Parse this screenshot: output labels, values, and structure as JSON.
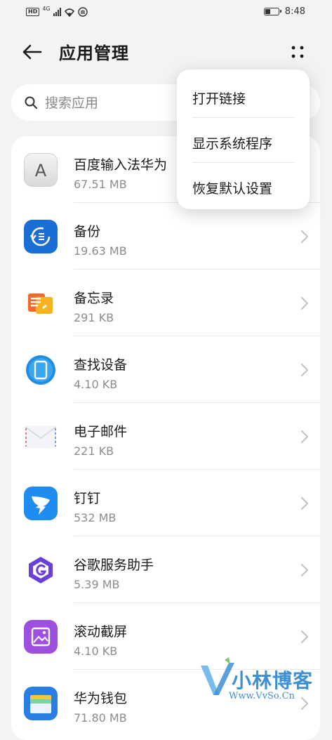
{
  "status_bar": {
    "network_badge": "HD",
    "network_type": "4G",
    "time": "8:48",
    "battery_level": 0.4
  },
  "header": {
    "title": "应用管理",
    "back_icon": "arrow-left-icon",
    "more_icon": "more-dots-icon"
  },
  "search": {
    "placeholder": "搜索应用",
    "value": ""
  },
  "apps": [
    {
      "name": "百度输入法华为",
      "size": "67.51 MB",
      "icon": "baidu-input-icon"
    },
    {
      "name": "备份",
      "size": "19.63 MB",
      "icon": "backup-icon"
    },
    {
      "name": "备忘录",
      "size": "291 KB",
      "icon": "notepad-icon"
    },
    {
      "name": "查找设备",
      "size": "4.10 KB",
      "icon": "find-device-icon"
    },
    {
      "name": "电子邮件",
      "size": "221 KB",
      "icon": "email-icon"
    },
    {
      "name": "钉钉",
      "size": "532 MB",
      "icon": "dingtalk-icon"
    },
    {
      "name": "谷歌服务助手",
      "size": "5.39 MB",
      "icon": "google-helper-icon"
    },
    {
      "name": "滚动截屏",
      "size": "4.10 KB",
      "icon": "scroll-screenshot-icon"
    },
    {
      "name": "华为钱包",
      "size": "71.80 MB",
      "icon": "wallet-icon"
    }
  ],
  "menu": {
    "items": [
      {
        "label": "打开链接"
      },
      {
        "label": "显示系统程序"
      },
      {
        "label": "恢复默认设置"
      }
    ]
  },
  "watermark": {
    "text": "小林博客",
    "url": "Www.VvSo.Cn"
  },
  "colors": {
    "background": "#f1f3f5",
    "card": "#ffffff",
    "text_primary": "#1a1a1a",
    "text_secondary": "#8c8c8c",
    "watermark": "#3d8fd6"
  }
}
